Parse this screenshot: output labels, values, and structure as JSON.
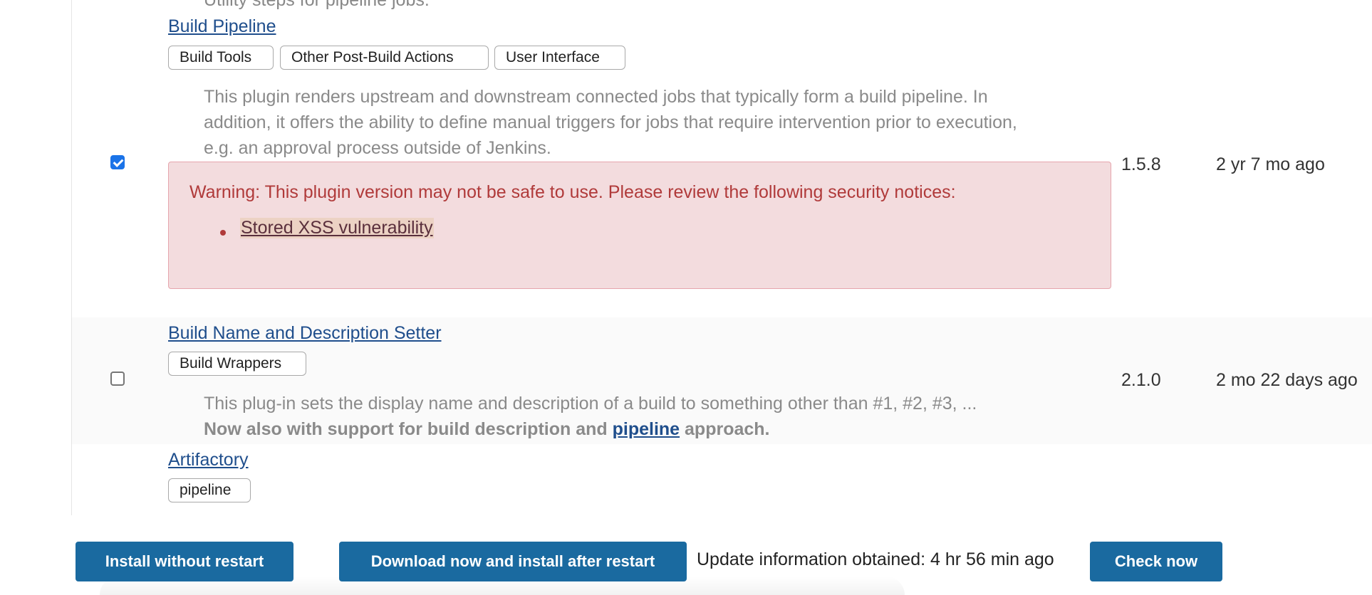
{
  "top_cutoff": {
    "text": "Utility steps for pipeline jobs."
  },
  "plugins": [
    {
      "name": "Build Pipeline",
      "checked": true,
      "tags": [
        "Build Tools",
        "Other Post-Build Actions",
        "User Interface"
      ],
      "description_lines": [
        "This plugin renders upstream and downstream connected jobs that typically form a build pipeline. In",
        "addition, it offers the ability to define manual triggers for jobs that require intervention prior to execution,",
        "e.g. an approval process outside of Jenkins."
      ],
      "warning": {
        "text": "Warning: This plugin version may not be safe to use. Please review the following security notices:",
        "link": "Stored XSS vulnerability"
      },
      "version": "1.5.8",
      "released": "2 yr 7 mo ago"
    },
    {
      "name": "Build Name and Description Setter",
      "checked": false,
      "tags": [
        "Build Wrappers"
      ],
      "description_line1": "This plug-in sets the display name and description of a build to something other than #1, #2, #3, ...",
      "description_line2_before": "Now also with support for build description and ",
      "description_line2_link": "pipeline",
      "description_line2_after": " approach.",
      "version": "2.1.0",
      "released": "2 mo 22 days ago"
    },
    {
      "name": "Artifactory",
      "tags": [
        "pipeline"
      ]
    }
  ],
  "footer": {
    "install_without_restart": "Install without restart",
    "download_install_after_restart": "Download now and install after restart",
    "update_info": "Update information obtained: 4 hr 56 min ago",
    "check_now": "Check now"
  },
  "colors": {
    "link": "#1f4e8c",
    "button": "#1a6aa0",
    "warning_bg": "#f3dcde",
    "warning_text": "#b03a3a",
    "checkbox_checked": "#1a73e8"
  }
}
